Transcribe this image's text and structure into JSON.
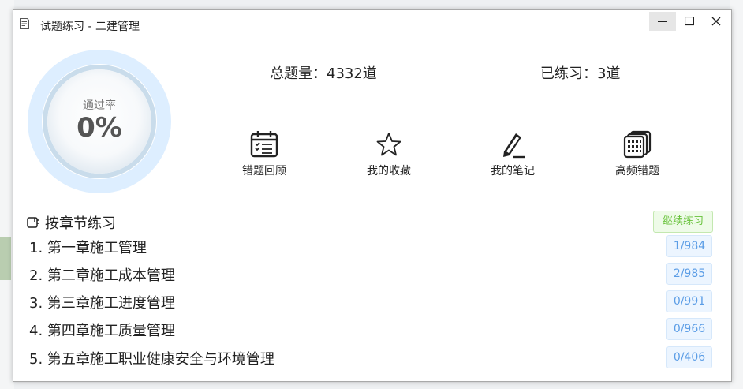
{
  "window": {
    "title": "试题练习 - 二建管理",
    "minimize_icon": "minimize-icon",
    "maximize_icon": "maximize-icon",
    "close_icon": "close-icon"
  },
  "gauge": {
    "label": "通过率",
    "value_text": "0%",
    "pass_rate": 0,
    "ring_color": "#ddeeff",
    "accent_color": "#c9dceb"
  },
  "stats": {
    "total_label": "总题量：4332道",
    "practiced_label": "已练习：3道"
  },
  "actions": [
    {
      "label": "错题回顾",
      "icon": "calendar-checklist-icon"
    },
    {
      "label": "我的收藏",
      "icon": "star-icon"
    },
    {
      "label": "我的笔记",
      "icon": "pen-note-icon"
    },
    {
      "label": "高频错题",
      "icon": "stacked-grid-icon"
    }
  ],
  "section": {
    "title": "按章节练习",
    "icon": "notebook-icon",
    "continue_label": "继续练习"
  },
  "chapters": [
    {
      "name": "1. 第一章施工管理",
      "progress": "1/984"
    },
    {
      "name": "2. 第二章施工成本管理",
      "progress": "2/985"
    },
    {
      "name": "3. 第三章施工进度管理",
      "progress": "0/991"
    },
    {
      "name": "4. 第四章施工质量管理",
      "progress": "0/966"
    },
    {
      "name": "5. 第五章施工职业健康安全与环境管理",
      "progress": "0/406"
    }
  ],
  "colors": {
    "continue_green": "#67c23a",
    "badge_blue": "#5b9de6"
  }
}
